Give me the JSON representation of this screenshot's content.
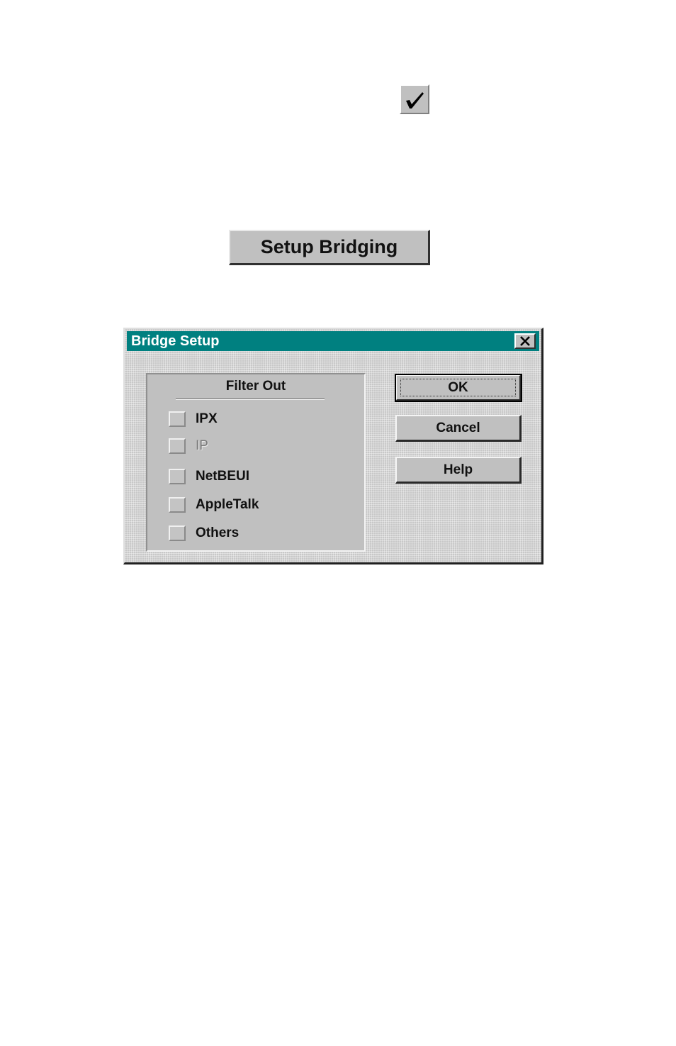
{
  "toolbar": {
    "check_button_icon": "checkmark-icon"
  },
  "setup_bridging_button": {
    "label": "Setup Bridging"
  },
  "dialog": {
    "title": "Bridge Setup",
    "close_icon": "close-icon",
    "title_bar_color": "#008080",
    "filter_group": {
      "title": "Filter Out",
      "options": [
        {
          "label": "IPX",
          "checked": false,
          "enabled": true
        },
        {
          "label": "IP",
          "checked": false,
          "enabled": false
        },
        {
          "label": "NetBEUI",
          "checked": false,
          "enabled": true
        },
        {
          "label": "AppleTalk",
          "checked": false,
          "enabled": true
        },
        {
          "label": "Others",
          "checked": false,
          "enabled": true
        }
      ]
    },
    "buttons": {
      "ok": "OK",
      "cancel": "Cancel",
      "help": "Help"
    }
  }
}
